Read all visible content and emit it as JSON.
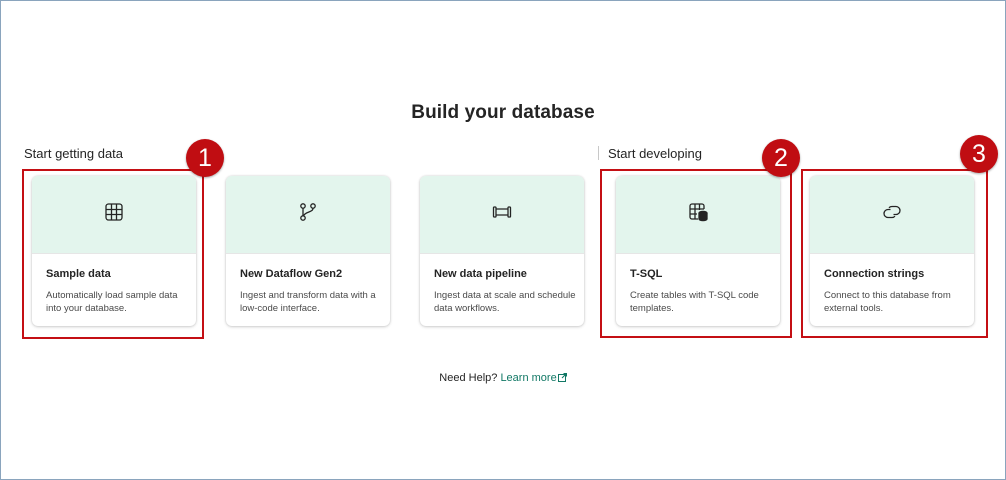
{
  "page": {
    "title": "Build your database"
  },
  "sections": {
    "getting_data": "Start getting data",
    "developing": "Start developing"
  },
  "cards": [
    {
      "title": "Sample data",
      "desc": "Automatically load sample data into your database.",
      "icon": "table-grid-icon"
    },
    {
      "title": "New Dataflow Gen2",
      "desc": "Ingest and transform data with a low-code interface.",
      "icon": "branch-icon"
    },
    {
      "title": "New data pipeline",
      "desc": "Ingest data at scale and schedule data workflows.",
      "icon": "pipeline-icon"
    },
    {
      "title": "T-SQL",
      "desc": "Create tables with T-SQL code templates.",
      "icon": "table-database-icon"
    },
    {
      "title": "Connection strings",
      "desc": "Connect to this database from external tools.",
      "icon": "link-icon"
    }
  ],
  "badges": [
    "1",
    "2",
    "3"
  ],
  "help": {
    "prefix": "Need Help?",
    "link": "Learn more"
  },
  "colors": {
    "card_header": "#e3f5ed",
    "highlight": "#c40f14",
    "link": "#117865"
  }
}
